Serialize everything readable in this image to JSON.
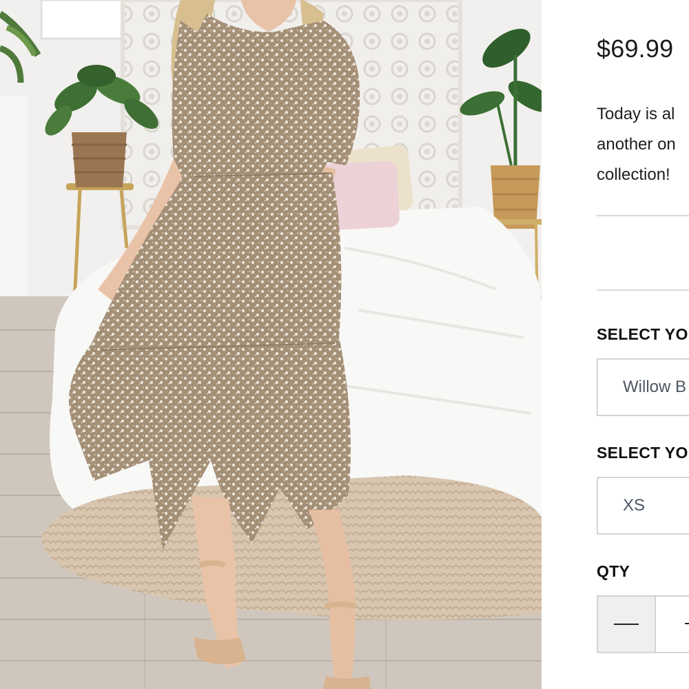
{
  "product": {
    "image_alt": "Model wearing a taupe floral tiered midi dress with short sleeves",
    "price": "$69.99",
    "description_lines": [
      "Today is al",
      "another on",
      "collection!"
    ]
  },
  "options": {
    "color_label": "SELECT YOU",
    "color_value": "Willow B",
    "size_label": "SELECT YOU",
    "size_value": "XS"
  },
  "quantity": {
    "label": "QTY",
    "decrement_icon": "minus-icon",
    "increment_icon": "plus-icon"
  },
  "colors": {
    "divider": "#d9d9d9",
    "field_border": "#d4d4d4",
    "field_text": "#4d5563",
    "stepper_bg": "#efefef"
  }
}
